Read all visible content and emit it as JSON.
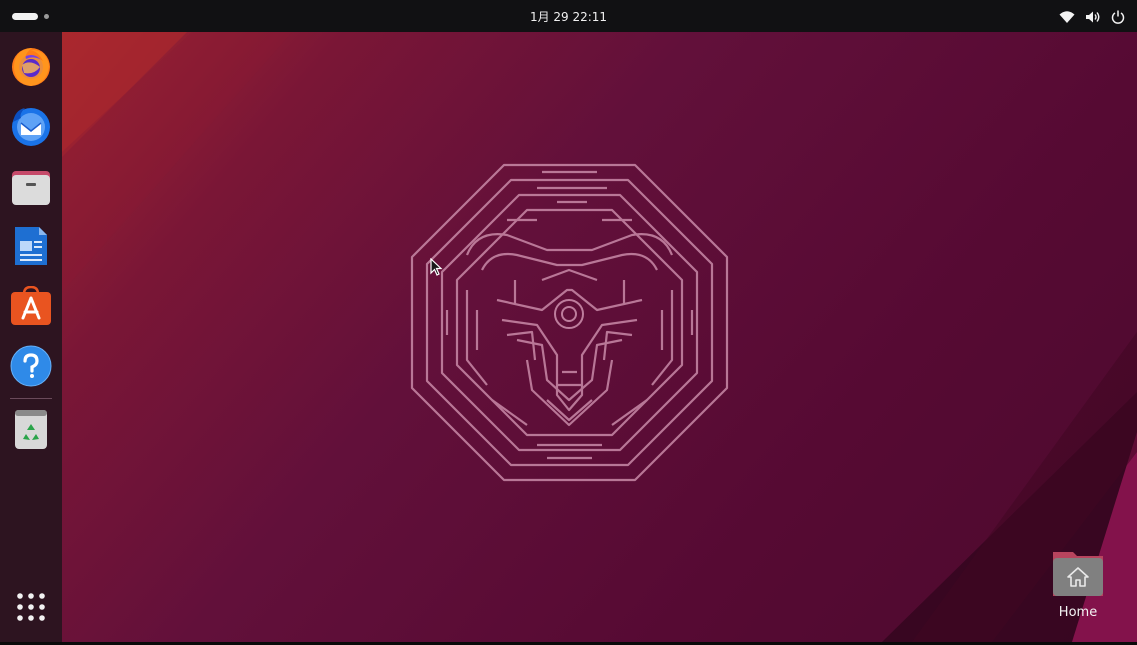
{
  "topbar": {
    "clock": "1月 29  22:11",
    "activities_icon": "activities-pill",
    "status_icons": [
      "wifi-icon",
      "volume-icon",
      "power-icon"
    ]
  },
  "dock": {
    "items": [
      {
        "name": "Firefox",
        "icon": "firefox-icon"
      },
      {
        "name": "Thunderbird",
        "icon": "thunderbird-icon"
      },
      {
        "name": "Files",
        "icon": "files-icon"
      },
      {
        "name": "LibreOffice Writer",
        "icon": "writer-icon"
      },
      {
        "name": "Ubuntu Software",
        "icon": "app-center-icon"
      },
      {
        "name": "Help",
        "icon": "help-icon"
      },
      {
        "name": "Trash",
        "icon": "trash-icon"
      }
    ],
    "apps_grid_icon": "show-apps-icon"
  },
  "desktop": {
    "icons": [
      {
        "label": "Home",
        "icon": "home-folder-icon"
      }
    ]
  },
  "colors": {
    "topbar": "#111113",
    "dock": "#2d1420",
    "wallpaper_main": "#560a30",
    "wallpaper_accent": "#a22630",
    "maze_line": "#c98aa8"
  }
}
